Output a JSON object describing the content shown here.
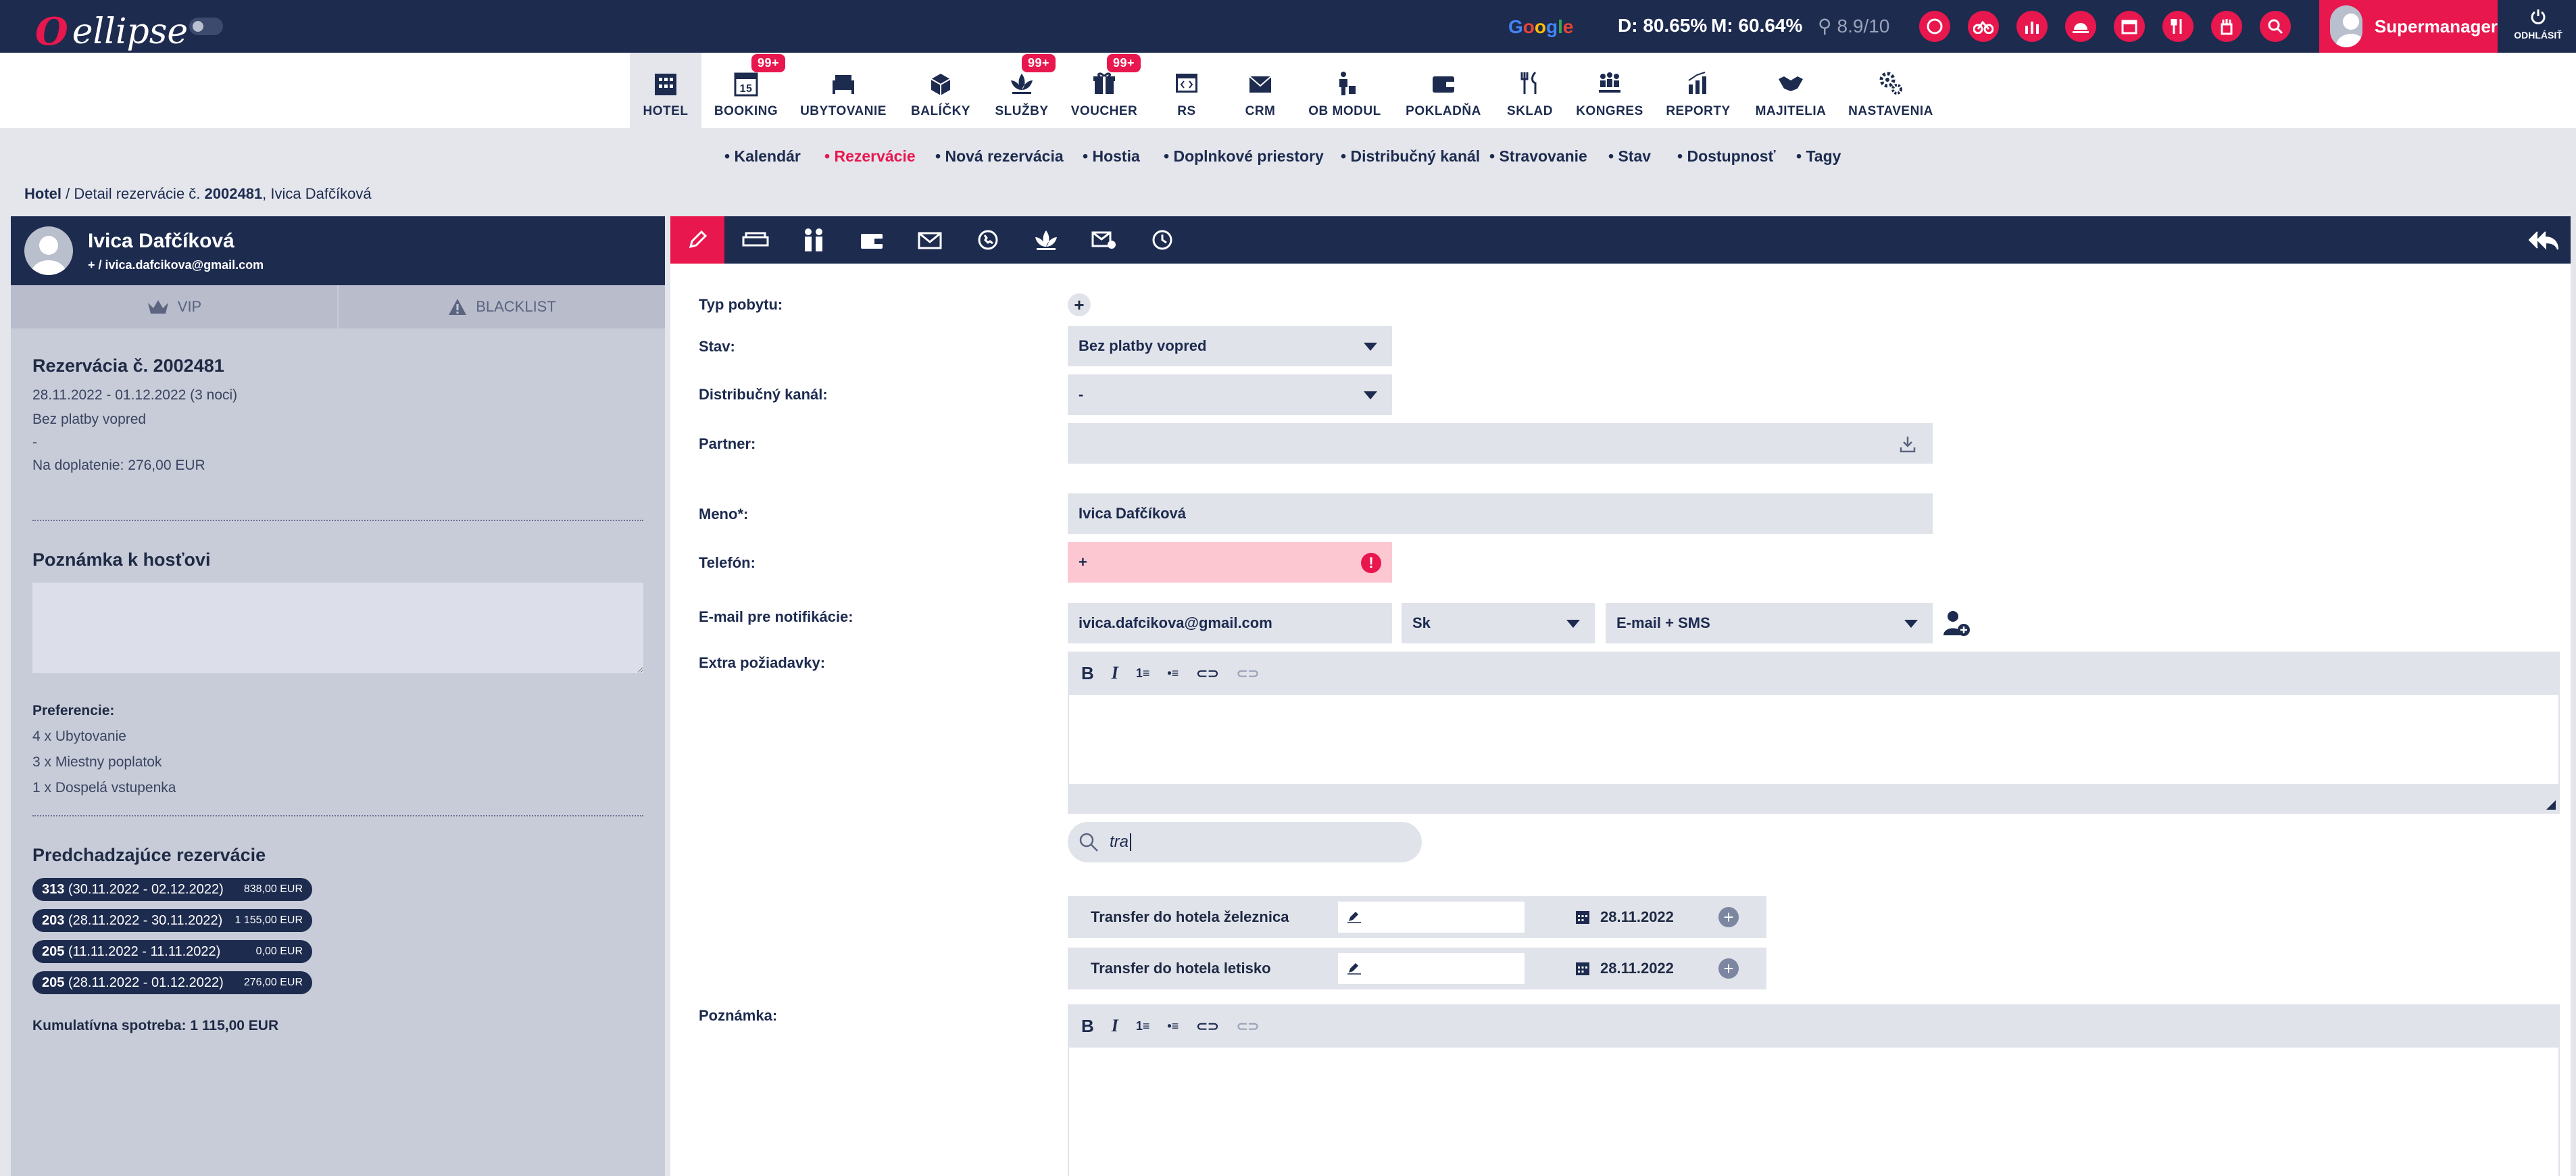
{
  "app": {
    "name": "ellipse"
  },
  "top": {
    "google_label": "Google",
    "d_stat": "D: 80.65%",
    "m_stat": "M: 60.64%",
    "rating": "8.9/10",
    "user_name": "Supermanager",
    "logout_label": "ODHLÁSIŤ"
  },
  "modules": [
    {
      "label": "HOTEL",
      "icon": "building-icon"
    },
    {
      "label": "BOOKING",
      "icon": "calendar-15-icon",
      "badge": "99+",
      "num": "15"
    },
    {
      "label": "UBYTOVANIE",
      "icon": "bed-icon"
    },
    {
      "label": "BALÍČKY",
      "icon": "package-icon"
    },
    {
      "label": "SLUŽBY",
      "icon": "lotus-icon",
      "badge": "99+"
    },
    {
      "label": "VOUCHER",
      "icon": "gift-icon",
      "badge": "99+"
    },
    {
      "label": "RS",
      "icon": "code-window-icon"
    },
    {
      "label": "CRM",
      "icon": "envelope-icon"
    },
    {
      "label": "OB MODUL",
      "icon": "person-bag-icon"
    },
    {
      "label": "POKLADŇA",
      "icon": "wallet-icon"
    },
    {
      "label": "SKLAD",
      "icon": "cutlery-icon"
    },
    {
      "label": "KONGRES",
      "icon": "group-icon"
    },
    {
      "label": "REPORTY",
      "icon": "chart-icon"
    },
    {
      "label": "MAJITELIA",
      "icon": "handshake-icon"
    },
    {
      "label": "NASTAVENIA",
      "icon": "gears-icon"
    }
  ],
  "subnav": [
    "Kalendár",
    "Rezervácie",
    "Nová rezervácia",
    "Hostia",
    "Doplnkové priestory",
    "Distribučný kanál",
    "Stravovanie",
    "Stav",
    "Dostupnosť",
    "Tagy"
  ],
  "breadcrumb": {
    "root": "Hotel",
    "middle": " / Detail rezervácie č. ",
    "number": "2002481",
    "tail": ", Ivica Dafčíková"
  },
  "guest": {
    "name": "Ivica Dafčíková",
    "contact": "+ / ivica.dafcikova@gmail.com",
    "vip_label": "VIP",
    "blacklist_label": "BLACKLIST",
    "reservation_title": "Rezervácia č. 2002481",
    "dates": "28.11.2022 - 01.12.2022 (3 noci)",
    "status": "Bez platby vopred",
    "dash": "-",
    "balance": "Na doplatenie: 276,00 EUR",
    "note_title": "Poznámka k hosťovi",
    "pref_title": "Preferencie:",
    "preferences": [
      "4 x Ubytovanie",
      "3 x Miestny poplatok",
      "1 x Dospelá vstupenka"
    ],
    "prev_title": "Predchadzajúce rezervácie",
    "previous": [
      {
        "room": "313",
        "dates": "(30.11.2022 - 02.12.2022)",
        "amount": "838,00 EUR"
      },
      {
        "room": "203",
        "dates": "(28.11.2022 - 30.11.2022)",
        "amount": "1 155,00 EUR"
      },
      {
        "room": "205",
        "dates": "(11.11.2022 - 11.11.2022)",
        "amount": "0,00 EUR"
      },
      {
        "room": "205",
        "dates": "(28.11.2022 - 01.12.2022)",
        "amount": "276,00 EUR"
      }
    ],
    "cumulative": "Kumulatívna spotreba: 1 115,00 EUR"
  },
  "form": {
    "typ_label": "Typ pobytu:",
    "stav_label": "Stav:",
    "stav_value": "Bez platby vopred",
    "kanal_label": "Distribučný kanál:",
    "kanal_value": "-",
    "partner_label": "Partner:",
    "meno_label": "Meno*:",
    "meno_value": "Ivica Dafčíková",
    "telefon_label": "Telefón:",
    "telefon_value": "+",
    "email_label": "E-mail pre notifikácie:",
    "email_value": "ivica.dafcikova@gmail.com",
    "lang_value": "Sk",
    "notif_value": "E-mail + SMS",
    "extra_label": "Extra požiadavky:",
    "search_value": "tra",
    "services": [
      {
        "name": "Transfer do hotela železnica",
        "date": "28.11.2022"
      },
      {
        "name": "Transfer do hotela letisko",
        "date": "28.11.2022"
      }
    ],
    "poznamka_label": "Poznámka:"
  }
}
